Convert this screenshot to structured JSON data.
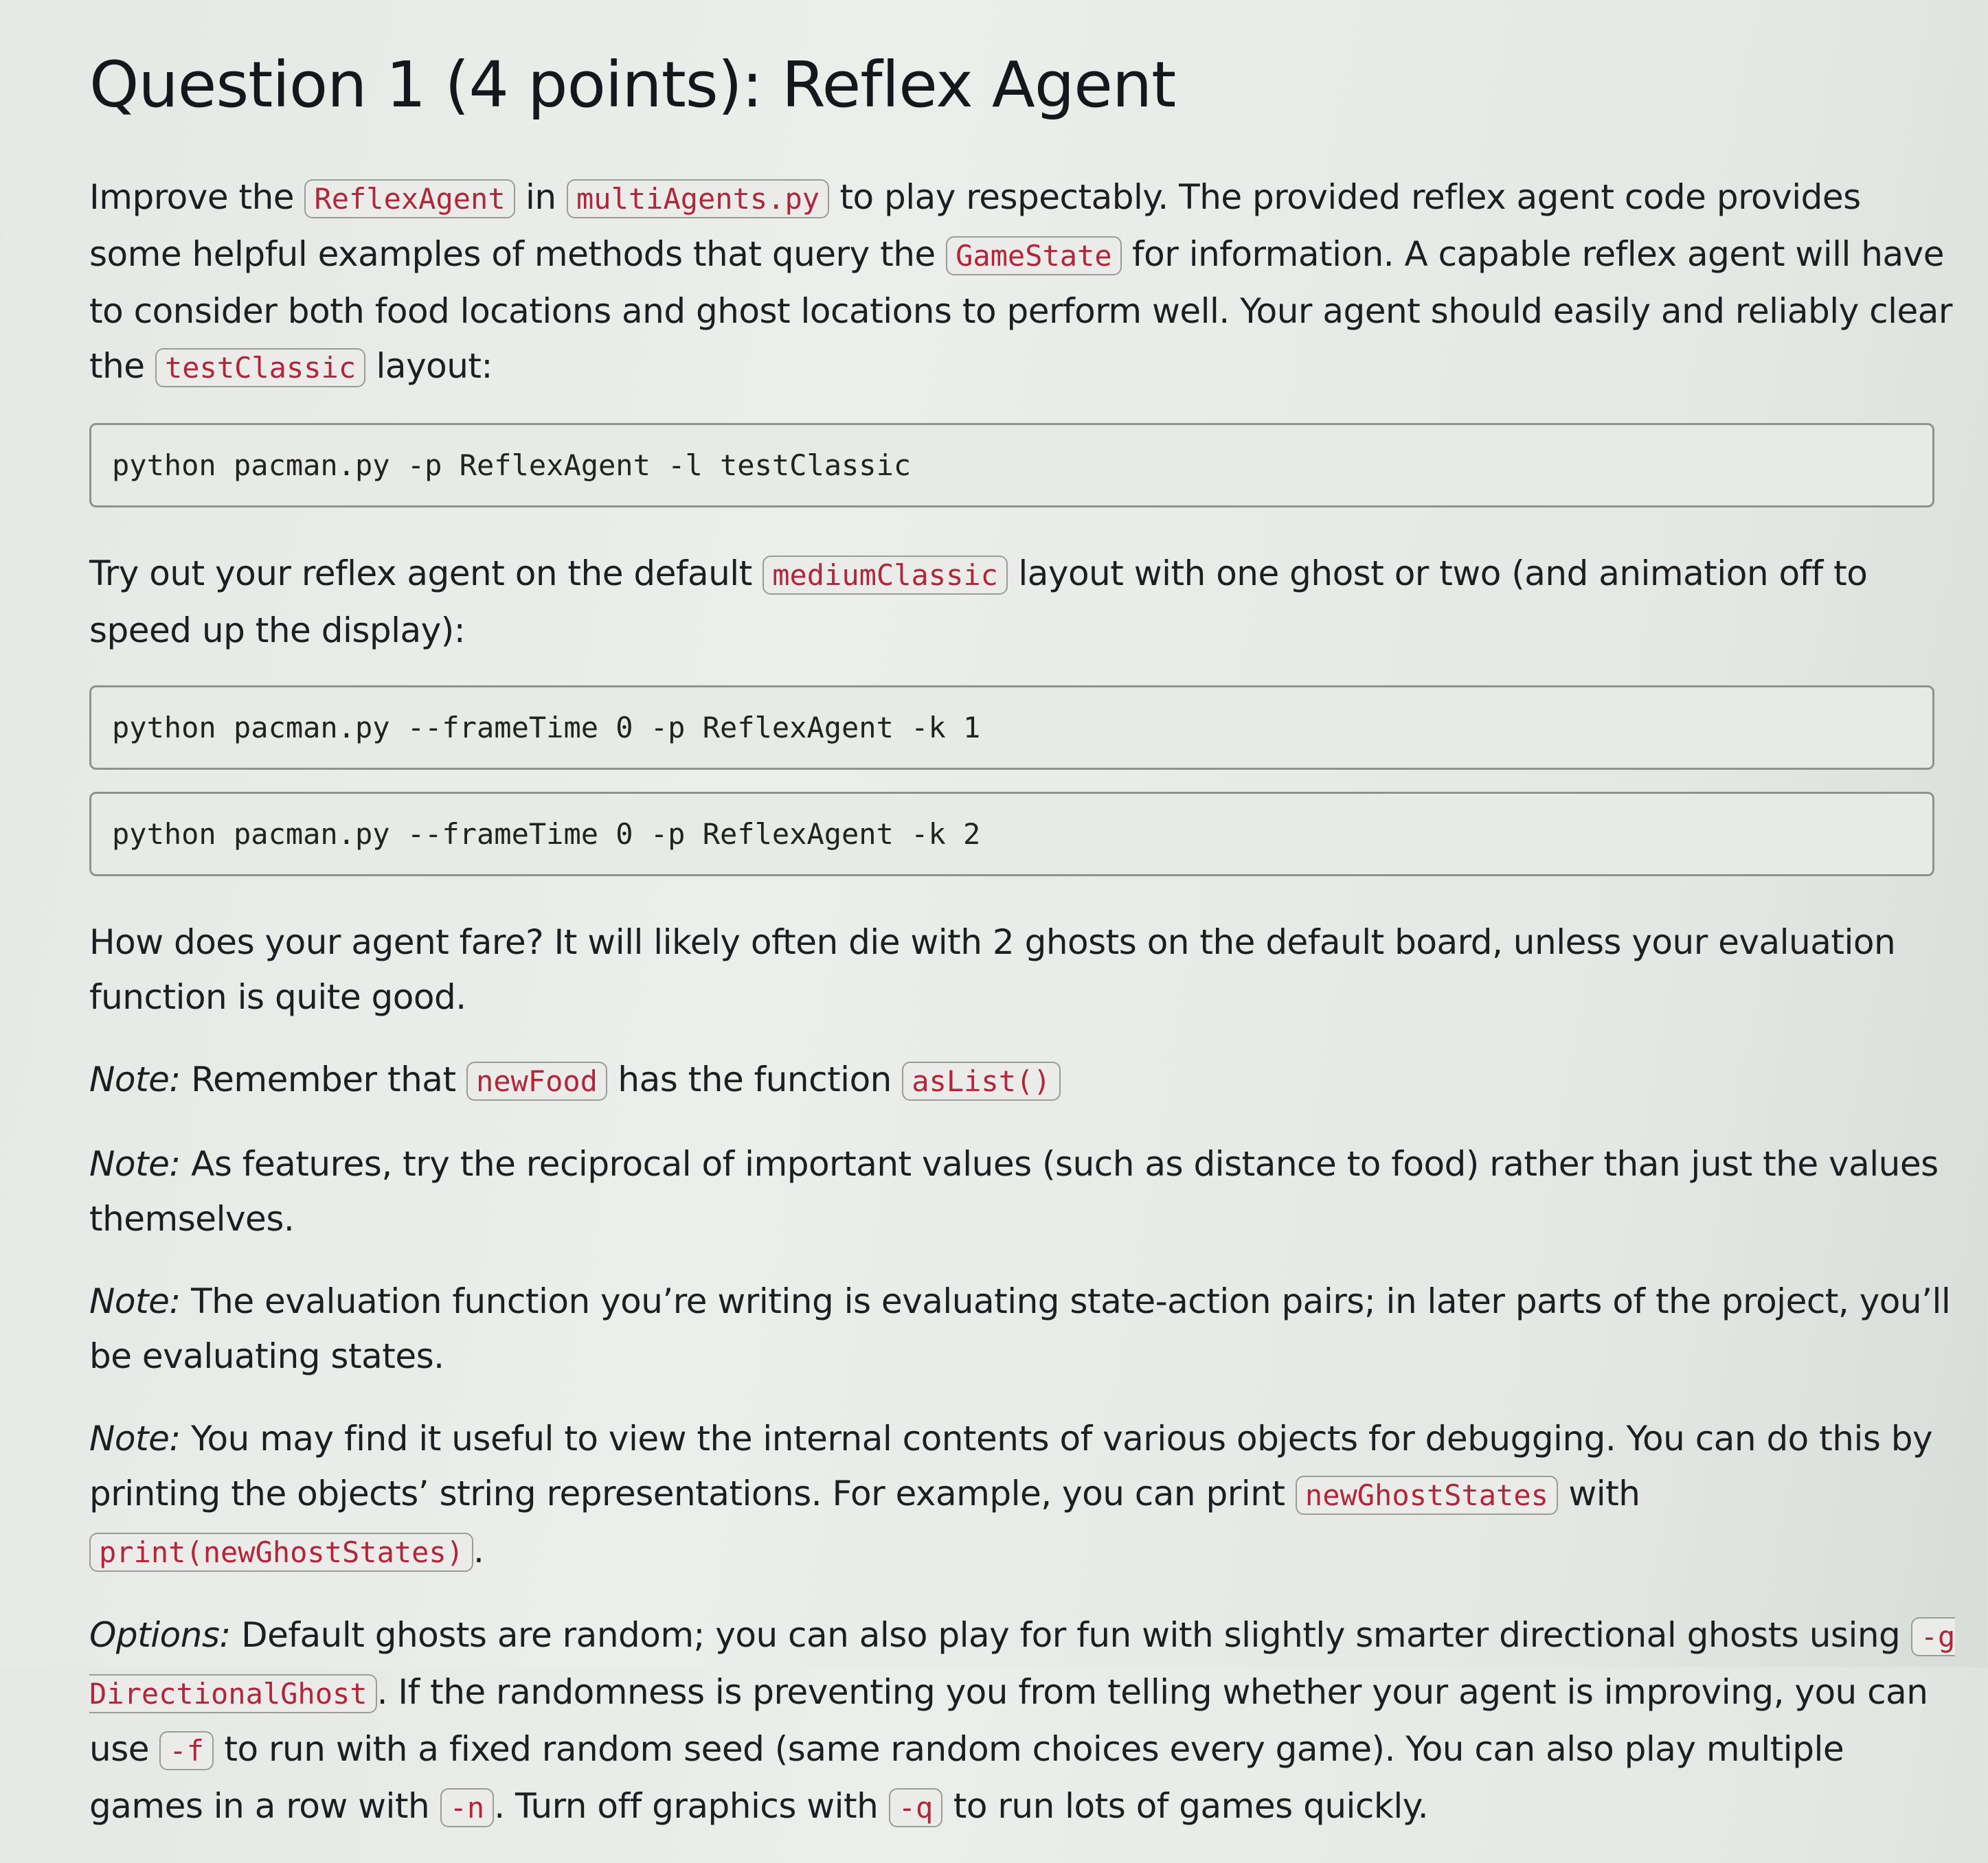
{
  "title": "Question 1 (4 points): Reflex Agent",
  "intro": {
    "t1": "Improve the",
    "c1": "ReflexAgent",
    "t2": "in",
    "c2": "multiAgents.py",
    "t3": "to play respectably. The provided reflex agent code provides some helpful examples of methods that query the",
    "c3": "GameState",
    "t4": "for information. A capable reflex agent will have to consider both food locations and ghost locations to perform well. Your agent should easily and reliably clear the",
    "c4": "testClassic",
    "t5": "layout:"
  },
  "cmd1": "python pacman.py -p ReflexAgent -l testClassic",
  "tryout": {
    "t1": "Try out your reflex agent on the default",
    "c1": "mediumClassic",
    "t2": "layout with one ghost or two (and animation off to speed up the display):"
  },
  "cmd2": "python pacman.py --frameTime 0 -p ReflexAgent -k 1",
  "cmd3": "python pacman.py --frameTime 0 -p ReflexAgent -k 2",
  "fare": "How does your agent fare? It will likely often die with 2 ghosts on the default board, unless your evaluation function is quite good.",
  "note1": {
    "label": "Note:",
    "t1": "Remember that",
    "c1": "newFood",
    "t2": "has the function",
    "c2": "asList()"
  },
  "note2": {
    "label": "Note:",
    "text": "As features, try the reciprocal of important values (such as distance to food) rather than just the values themselves."
  },
  "note3": {
    "label": "Note:",
    "text": "The evaluation function you’re writing is evaluating state-action pairs; in later parts of the project, you’ll be evaluating states."
  },
  "note4": {
    "label": "Note:",
    "t1": "You may find it useful to view the internal contents of various objects for debugging. You can do this by printing the objects’ string representations. For example, you can print",
    "c1": "newGhostStates",
    "t2": "with",
    "c2": "print(newGhostStates)",
    "t3": "."
  },
  "options": {
    "label": "Options:",
    "t1": "Default ghosts are random; you can also play for fun with slightly smarter directional ghosts using",
    "c1": "-g DirectionalGhost",
    "t2": ". If the randomness is preventing you from telling whether your agent is improving, you can use",
    "c2": "-f",
    "t3": "to run with a fixed random seed (same random choices every game). You can also play multiple games in a row with",
    "c3": "-n",
    "t4": ". Turn off graphics with",
    "c4": "-q",
    "t5": "to run lots of games quickly."
  }
}
